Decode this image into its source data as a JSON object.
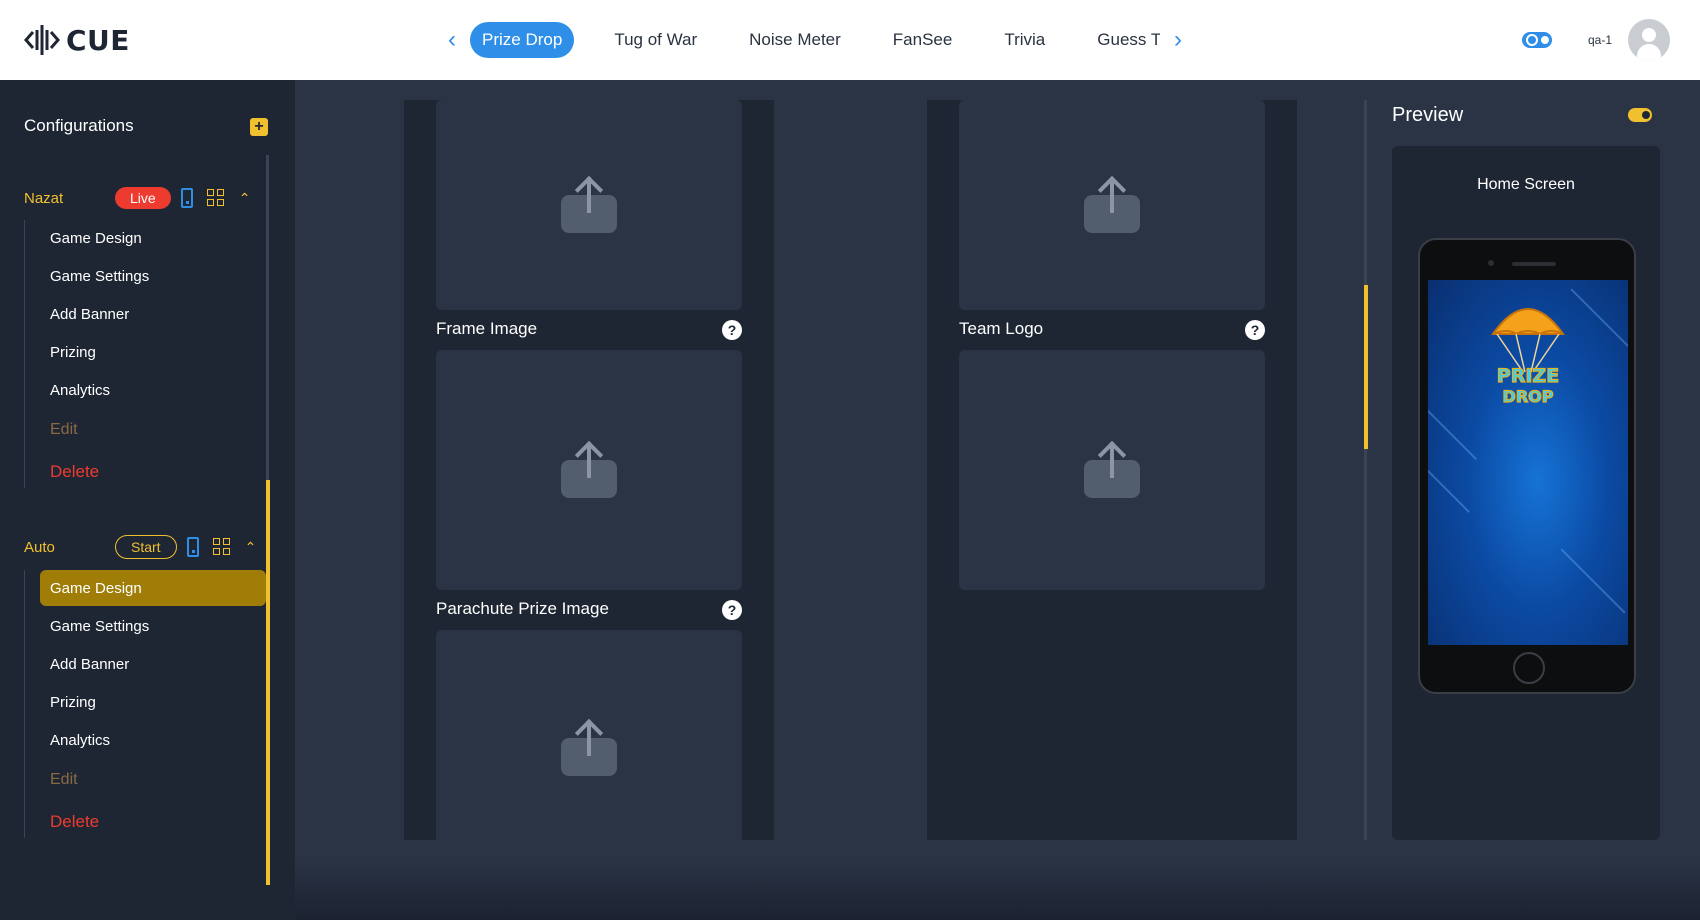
{
  "app": {
    "logo_text": "CUE",
    "user": "qa-1"
  },
  "tabs": [
    {
      "label": "Prize Drop",
      "active": true
    },
    {
      "label": "Tug of War",
      "active": false
    },
    {
      "label": "Noise Meter",
      "active": false
    },
    {
      "label": "FanSee",
      "active": false
    },
    {
      "label": "Trivia",
      "active": false
    },
    {
      "label": "Guess The Sco",
      "active": false
    }
  ],
  "sidebar": {
    "title": "Configurations",
    "groups": [
      {
        "name": "Nazat",
        "status": "Live",
        "items": [
          "Game Design",
          "Game Settings",
          "Add Banner",
          "Prizing",
          "Analytics",
          "Edit",
          "Delete"
        ]
      },
      {
        "name": "Auto",
        "status": "Start",
        "active_item": "Game Design",
        "items": [
          "Game Design",
          "Game Settings",
          "Add Banner",
          "Prizing",
          "Analytics",
          "Edit",
          "Delete"
        ]
      }
    ]
  },
  "fields": {
    "frame_image": "Frame Image",
    "parachute_prize_image": "Parachute Prize Image",
    "team_logo": "Team Logo",
    "help_glyph": "?"
  },
  "preview": {
    "title": "Preview",
    "screen_label": "Home Screen",
    "logo_word_1": "PRIZE",
    "logo_word_2": "DROP"
  },
  "colors": {
    "accent_yellow": "#f0c02f",
    "accent_blue": "#2f8fe8",
    "live_red": "#ee3b2f",
    "sidebar_bg": "#1f2633",
    "main_bg": "#2a3445"
  },
  "icons": [
    "logo-soundwave-icon",
    "chevron-left-icon",
    "chevron-right-icon",
    "theme-toggle-icon",
    "avatar-icon",
    "plus-icon",
    "phone-icon",
    "qr-code-icon",
    "chevron-up-icon",
    "upload-icon",
    "help-icon",
    "toggle-icon"
  ]
}
